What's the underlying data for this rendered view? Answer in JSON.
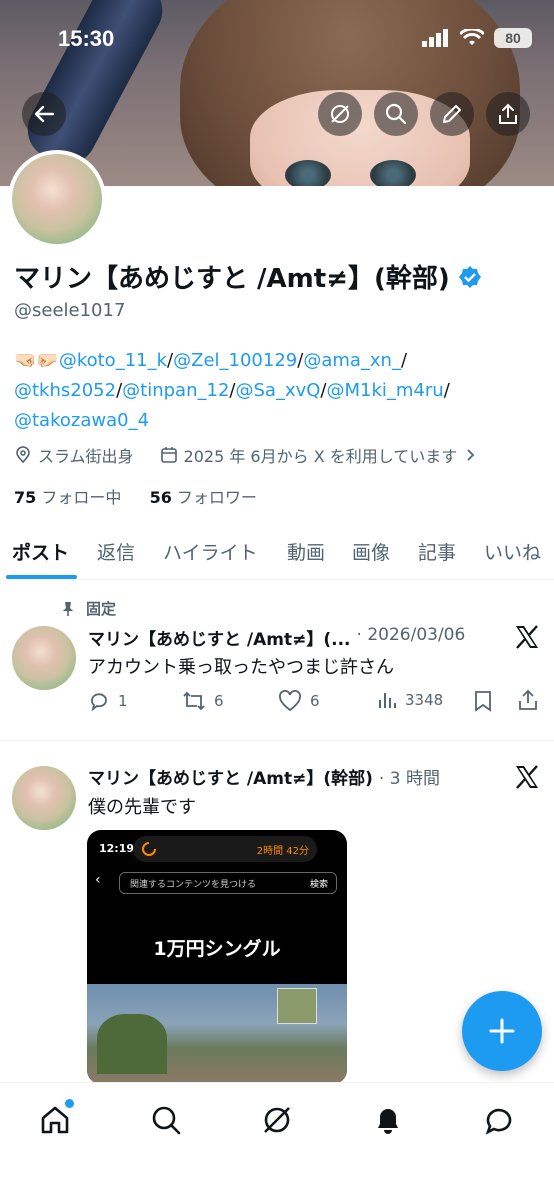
{
  "status_bar": {
    "time": "15:30",
    "battery": "80"
  },
  "profile": {
    "name": "マリン【あめじすと /Amt≠】(幹部)",
    "handle": "@seele1017",
    "bio_prefix": "🤜🏻🤛🏻",
    "bio_links": [
      "@koto_11_k",
      "@Zel_100129",
      "@ama_xn_",
      "@tkhs2052",
      "@tinpan_12",
      "@Sa_xvQ",
      "@M1ki_m4ru",
      "@takozawa0_4"
    ],
    "location": "スラム街出身",
    "joined": "2025 年 6月から X を利用しています",
    "following_count": "75",
    "following_label": "フォロー中",
    "followers_count": "56",
    "followers_label": "フォロワー"
  },
  "tabs": [
    "ポスト",
    "返信",
    "ハイライト",
    "動画",
    "画像",
    "記事",
    "いいね"
  ],
  "pinned_tweet": {
    "pinned_label": "固定",
    "name": "マリン【あめじすと /Amt≠】(...",
    "date": "· 2026/03/06",
    "text": "アカウント乗っ取ったやつまじ許さん",
    "replies": "1",
    "retweets": "6",
    "likes": "6",
    "views": "3348"
  },
  "tweet2": {
    "name": "マリン【あめじすと /Amt≠】(幹部)",
    "time": "· 3 時間",
    "text": "僕の先輩です",
    "media": {
      "time": "12:19",
      "timer": "2時間 42分",
      "search_placeholder": "関連するコンテンツを見つける",
      "search_button": "検索",
      "title": "1万円シングル"
    }
  },
  "colors": {
    "accent": "#1d9bf0",
    "text": "#0f1419",
    "muted": "#536471"
  }
}
